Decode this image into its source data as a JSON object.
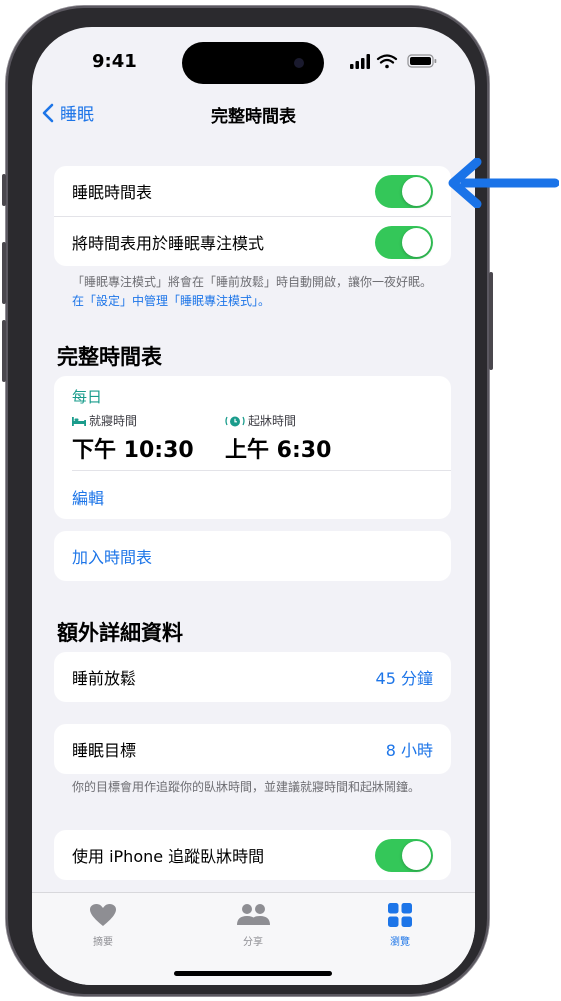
{
  "status_bar": {
    "time": "9:41"
  },
  "nav": {
    "back_label": "睡眠",
    "title": "完整時間表"
  },
  "settings_group": {
    "rows": [
      {
        "label": "睡眠時間表",
        "toggle_on": true
      },
      {
        "label": "將時間表用於睡眠專注模式",
        "toggle_on": true
      }
    ],
    "footnote_text": "「睡眠專注模式」將會在「睡前放鬆」時自動開啟，讓你一夜好眠。",
    "footnote_link": "在「設定」中管理「睡眠專注模式」。"
  },
  "full_schedule": {
    "section_title": "完整時間表",
    "repeat": "每日",
    "bedtime_label": "就寢時間",
    "bedtime_value": "下午 10:30",
    "wake_label": "起牀時間",
    "wake_value": "上午 6:30",
    "edit_label": "編輯",
    "add_label": "加入時間表"
  },
  "additional_details": {
    "section_title": "額外詳細資料",
    "wind_down_label": "睡前放鬆",
    "wind_down_value": "45 分鐘",
    "sleep_goal_label": "睡眠目標",
    "sleep_goal_value": "8 小時",
    "goal_footnote": "你的目標會用作追蹤你的臥牀時間，並建議就寢時間和起牀鬧鐘。",
    "track_label": "使用 iPhone 追蹤臥牀時間",
    "track_on": true
  },
  "tab_bar": {
    "tabs": [
      {
        "label": "摘要",
        "icon": "heart-icon",
        "active": false
      },
      {
        "label": "分享",
        "icon": "people-icon",
        "active": false
      },
      {
        "label": "瀏覽",
        "icon": "grid-icon",
        "active": true
      }
    ]
  },
  "colors": {
    "accent": "#1d75e8",
    "toggle_on": "#34c759",
    "schedule_accent": "#1a9c8c",
    "callout_arrow": "#1a73e8"
  }
}
